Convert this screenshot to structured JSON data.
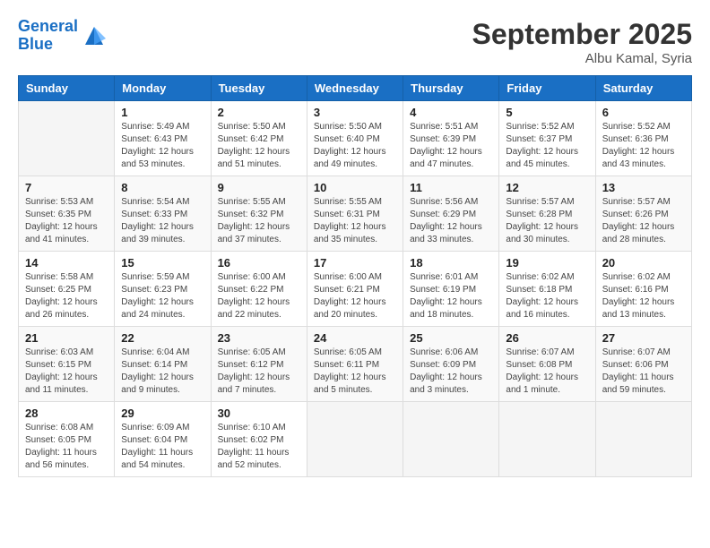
{
  "header": {
    "logo_line1": "General",
    "logo_line2": "Blue",
    "month_title": "September 2025",
    "location": "Albu Kamal, Syria"
  },
  "weekdays": [
    "Sunday",
    "Monday",
    "Tuesday",
    "Wednesday",
    "Thursday",
    "Friday",
    "Saturday"
  ],
  "weeks": [
    [
      {
        "day": "",
        "info": ""
      },
      {
        "day": "1",
        "info": "Sunrise: 5:49 AM\nSunset: 6:43 PM\nDaylight: 12 hours\nand 53 minutes."
      },
      {
        "day": "2",
        "info": "Sunrise: 5:50 AM\nSunset: 6:42 PM\nDaylight: 12 hours\nand 51 minutes."
      },
      {
        "day": "3",
        "info": "Sunrise: 5:50 AM\nSunset: 6:40 PM\nDaylight: 12 hours\nand 49 minutes."
      },
      {
        "day": "4",
        "info": "Sunrise: 5:51 AM\nSunset: 6:39 PM\nDaylight: 12 hours\nand 47 minutes."
      },
      {
        "day": "5",
        "info": "Sunrise: 5:52 AM\nSunset: 6:37 PM\nDaylight: 12 hours\nand 45 minutes."
      },
      {
        "day": "6",
        "info": "Sunrise: 5:52 AM\nSunset: 6:36 PM\nDaylight: 12 hours\nand 43 minutes."
      }
    ],
    [
      {
        "day": "7",
        "info": "Sunrise: 5:53 AM\nSunset: 6:35 PM\nDaylight: 12 hours\nand 41 minutes."
      },
      {
        "day": "8",
        "info": "Sunrise: 5:54 AM\nSunset: 6:33 PM\nDaylight: 12 hours\nand 39 minutes."
      },
      {
        "day": "9",
        "info": "Sunrise: 5:55 AM\nSunset: 6:32 PM\nDaylight: 12 hours\nand 37 minutes."
      },
      {
        "day": "10",
        "info": "Sunrise: 5:55 AM\nSunset: 6:31 PM\nDaylight: 12 hours\nand 35 minutes."
      },
      {
        "day": "11",
        "info": "Sunrise: 5:56 AM\nSunset: 6:29 PM\nDaylight: 12 hours\nand 33 minutes."
      },
      {
        "day": "12",
        "info": "Sunrise: 5:57 AM\nSunset: 6:28 PM\nDaylight: 12 hours\nand 30 minutes."
      },
      {
        "day": "13",
        "info": "Sunrise: 5:57 AM\nSunset: 6:26 PM\nDaylight: 12 hours\nand 28 minutes."
      }
    ],
    [
      {
        "day": "14",
        "info": "Sunrise: 5:58 AM\nSunset: 6:25 PM\nDaylight: 12 hours\nand 26 minutes."
      },
      {
        "day": "15",
        "info": "Sunrise: 5:59 AM\nSunset: 6:23 PM\nDaylight: 12 hours\nand 24 minutes."
      },
      {
        "day": "16",
        "info": "Sunrise: 6:00 AM\nSunset: 6:22 PM\nDaylight: 12 hours\nand 22 minutes."
      },
      {
        "day": "17",
        "info": "Sunrise: 6:00 AM\nSunset: 6:21 PM\nDaylight: 12 hours\nand 20 minutes."
      },
      {
        "day": "18",
        "info": "Sunrise: 6:01 AM\nSunset: 6:19 PM\nDaylight: 12 hours\nand 18 minutes."
      },
      {
        "day": "19",
        "info": "Sunrise: 6:02 AM\nSunset: 6:18 PM\nDaylight: 12 hours\nand 16 minutes."
      },
      {
        "day": "20",
        "info": "Sunrise: 6:02 AM\nSunset: 6:16 PM\nDaylight: 12 hours\nand 13 minutes."
      }
    ],
    [
      {
        "day": "21",
        "info": "Sunrise: 6:03 AM\nSunset: 6:15 PM\nDaylight: 12 hours\nand 11 minutes."
      },
      {
        "day": "22",
        "info": "Sunrise: 6:04 AM\nSunset: 6:14 PM\nDaylight: 12 hours\nand 9 minutes."
      },
      {
        "day": "23",
        "info": "Sunrise: 6:05 AM\nSunset: 6:12 PM\nDaylight: 12 hours\nand 7 minutes."
      },
      {
        "day": "24",
        "info": "Sunrise: 6:05 AM\nSunset: 6:11 PM\nDaylight: 12 hours\nand 5 minutes."
      },
      {
        "day": "25",
        "info": "Sunrise: 6:06 AM\nSunset: 6:09 PM\nDaylight: 12 hours\nand 3 minutes."
      },
      {
        "day": "26",
        "info": "Sunrise: 6:07 AM\nSunset: 6:08 PM\nDaylight: 12 hours\nand 1 minute."
      },
      {
        "day": "27",
        "info": "Sunrise: 6:07 AM\nSunset: 6:06 PM\nDaylight: 11 hours\nand 59 minutes."
      }
    ],
    [
      {
        "day": "28",
        "info": "Sunrise: 6:08 AM\nSunset: 6:05 PM\nDaylight: 11 hours\nand 56 minutes."
      },
      {
        "day": "29",
        "info": "Sunrise: 6:09 AM\nSunset: 6:04 PM\nDaylight: 11 hours\nand 54 minutes."
      },
      {
        "day": "30",
        "info": "Sunrise: 6:10 AM\nSunset: 6:02 PM\nDaylight: 11 hours\nand 52 minutes."
      },
      {
        "day": "",
        "info": ""
      },
      {
        "day": "",
        "info": ""
      },
      {
        "day": "",
        "info": ""
      },
      {
        "day": "",
        "info": ""
      }
    ]
  ]
}
